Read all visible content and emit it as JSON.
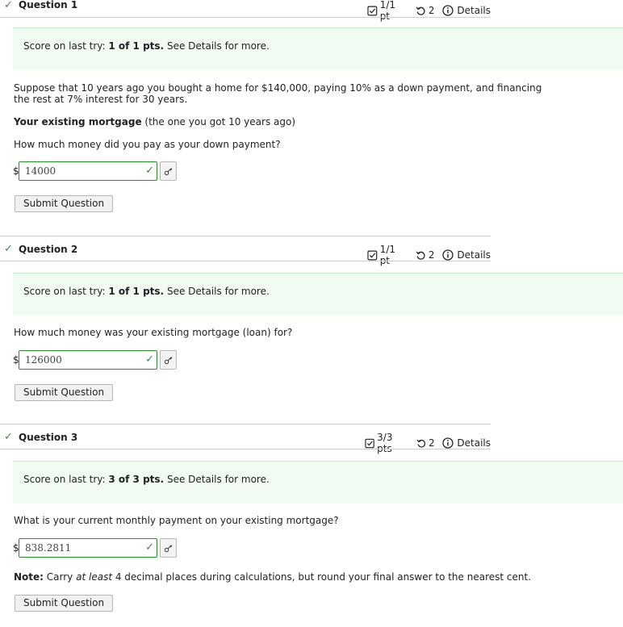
{
  "questions": [
    {
      "title": "Question 1",
      "points": "1/1 pt",
      "attempts": "2",
      "details": "Details",
      "score_prefix": "Score on last try:",
      "score_value": "1 of 1 pts.",
      "score_suffix": "See Details for more.",
      "currency": "$",
      "answer": "14000",
      "submit_label": "Submit Question"
    },
    {
      "title": "Question 2",
      "points": "1/1 pt",
      "attempts": "2",
      "details": "Details",
      "score_prefix": "Score on last try:",
      "score_value": "1 of 1 pts.",
      "score_suffix": "See Details for more.",
      "prompt": "How much money was your existing mortgage (loan) for?",
      "currency": "$",
      "answer": "126000",
      "submit_label": "Submit Question"
    },
    {
      "title": "Question 3",
      "points": "3/3 pts",
      "attempts": "2",
      "details": "Details",
      "score_prefix": "Score on last try:",
      "score_value": "3 of 3 pts.",
      "score_suffix": "See Details for more.",
      "prompt": "What is your current monthly payment on your existing mortgage?",
      "currency": "$",
      "answer": "838.2811",
      "note_label": "Note:",
      "note_pre": "Carry",
      "note_emphasis": "at least",
      "note_post": "4 decimal places during calculations, but round your final answer to the nearest cent.",
      "submit_label": "Submit Question"
    }
  ],
  "scenario": {
    "line1": "Suppose that 10 years ago you bought a home for $140,000, paying 10% as a down payment, and financing",
    "line2": "the rest at 7% interest for 30 years.",
    "existing_label": "Your existing mortgage",
    "existing_suffix": "(the one you got 10 years ago)",
    "q1_prompt": "How much money did you pay as your down payment?"
  },
  "icons": {
    "check": "check-icon",
    "points": "checkbox-icon",
    "attempts": "retry-icon",
    "details": "info-icon",
    "key": "key-icon"
  },
  "colors": {
    "success": "#3d8b3d",
    "score_bg": "#f1fbf1",
    "answer_border": "#2e8b2e"
  }
}
